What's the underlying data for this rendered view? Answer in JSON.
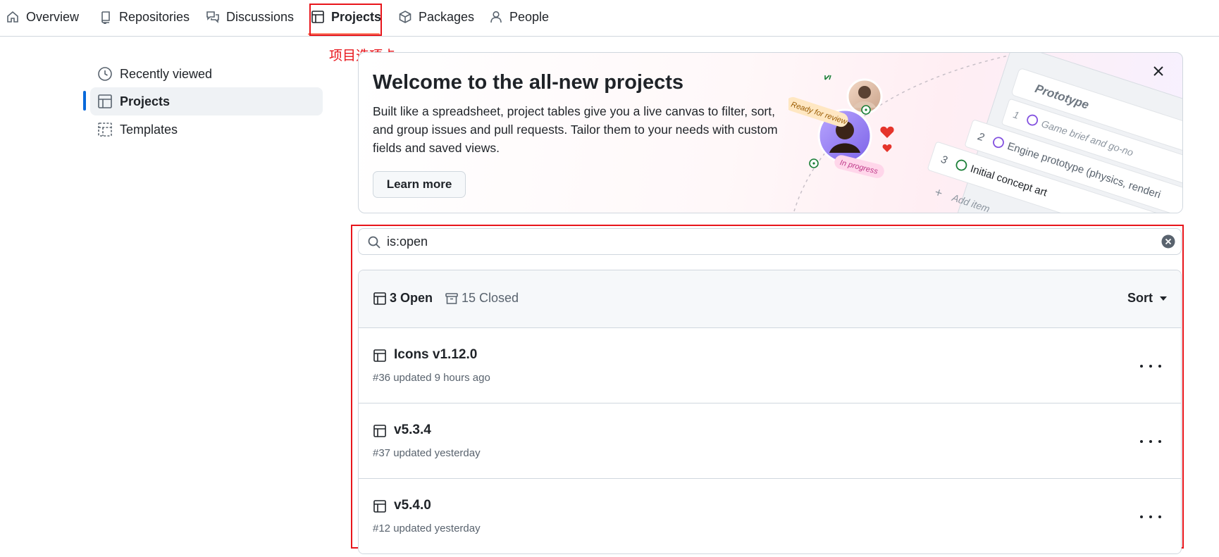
{
  "nav": {
    "items": [
      {
        "label": "Overview",
        "icon": "home-icon"
      },
      {
        "label": "Repositories",
        "icon": "repo-icon"
      },
      {
        "label": "Discussions",
        "icon": "discussions-icon"
      },
      {
        "label": "Projects",
        "icon": "table-icon",
        "active": true
      },
      {
        "label": "Packages",
        "icon": "package-icon"
      },
      {
        "label": "People",
        "icon": "person-icon"
      }
    ]
  },
  "annotation": {
    "label": "项目选项卡",
    "color": "#e8151b"
  },
  "sidebar": {
    "items": [
      {
        "label": "Recently viewed",
        "icon": "clock-icon"
      },
      {
        "label": "Projects",
        "icon": "table-icon",
        "active": true
      },
      {
        "label": "Templates",
        "icon": "template-icon"
      }
    ]
  },
  "banner": {
    "title": "Welcome to the all-new projects",
    "body": "Built like a spreadsheet, project tables give you a live canvas to filter, sort, and group issues and pull requests. Tailor them to your needs with custom fields and saved views.",
    "learn_more": "Learn more",
    "illustration": {
      "tags": [
        "Ready for review",
        "In progress"
      ],
      "group_label": "Prototype",
      "group_count": "3",
      "items": [
        {
          "num": "1",
          "label": "Game brief and go-no"
        },
        {
          "num": "2",
          "label": "Engine prototype (physics, renderi"
        },
        {
          "num": "3",
          "label": "Initial concept art"
        }
      ],
      "add_item": "Add item"
    }
  },
  "search": {
    "value": "is:open"
  },
  "list": {
    "open_label": "3 Open",
    "closed_label": "15 Closed",
    "sort_label": "Sort",
    "projects": [
      {
        "title": "Icons v1.12.0",
        "meta": "#36 updated 9 hours ago"
      },
      {
        "title": "v5.3.4",
        "meta": "#37 updated yesterday"
      },
      {
        "title": "v5.4.0",
        "meta": "#12 updated yesterday"
      }
    ]
  },
  "colors": {
    "accent": "#0969da",
    "tab_underline": "#fd8c73",
    "annotation": "#e8151b",
    "open_status": "#1a7f37"
  }
}
